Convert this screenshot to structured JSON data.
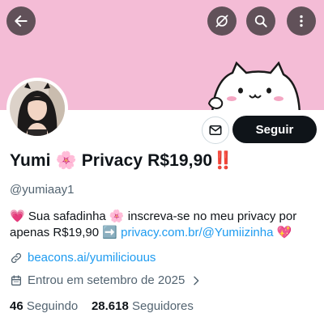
{
  "profile": {
    "name": "Yumi 🌸 Privacy R$19,90‼️",
    "handle": "@yumiaay1",
    "follow_label": "Seguir",
    "bio": {
      "text1": "💗 Sua safadinha 🌸 inscreva-se no meu privacy por apenas R$19,90 ➡️ ",
      "link": "privacy.com.br/@Yumiizinha",
      "text2": " 💖"
    },
    "website": "beacons.ai/yumiliciouus",
    "joined": "Entrou em setembro de 2025",
    "following_count": "46",
    "following_label": "Seguindo",
    "followers_count": "28.618",
    "followers_label": "Seguidores"
  },
  "icons": {
    "back": "back-arrow-icon",
    "hide": "eye-slash-icon",
    "search": "search-icon",
    "more": "more-vertical-icon",
    "message": "envelope-icon",
    "link": "link-icon",
    "calendar": "calendar-icon",
    "chevron": "chevron-right-icon"
  },
  "colors": {
    "banner": "#f4bcd6",
    "link": "#1d9bf0",
    "follow_bg": "#0f1419",
    "secondary_text": "#536471"
  }
}
